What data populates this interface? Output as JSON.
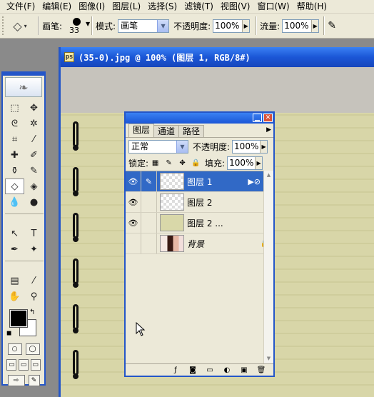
{
  "menu": [
    "文件(F)",
    "编辑(E)",
    "图像(I)",
    "图层(L)",
    "选择(S)",
    "滤镜(T)",
    "视图(V)",
    "窗口(W)",
    "帮助(H)"
  ],
  "options": {
    "brush_label": "画笔:",
    "brush_size": "33",
    "mode_label": "模式:",
    "mode_value": "画笔",
    "opacity_label": "不透明度:",
    "opacity_value": "100%",
    "flow_label": "流量:",
    "flow_value": "100%"
  },
  "document": {
    "title": "(35-0).jpg @ 100% (图层 1, RGB/8#)"
  },
  "layers_panel": {
    "tabs": [
      "图层",
      "通道",
      "路径"
    ],
    "active_tab": "图层",
    "blend_mode": "正常",
    "opacity_label": "不透明度:",
    "opacity_value": "100%",
    "lock_label": "锁定:",
    "fill_label": "填充:",
    "fill_value": "100%",
    "layers": [
      {
        "name": "图层 1",
        "visible": true,
        "selected": true,
        "thumb": "transparent"
      },
      {
        "name": "图层 2",
        "visible": true,
        "selected": false,
        "thumb": "transparent"
      },
      {
        "name": "图层 2 ...",
        "visible": true,
        "selected": false,
        "thumb": "paper"
      },
      {
        "name": "背景",
        "visible": false,
        "selected": false,
        "thumb": "photo",
        "locked": true
      }
    ]
  },
  "colors": {
    "titlebar": "#1b56d6",
    "selected_layer": "#3169c6",
    "chrome": "#ece9d8",
    "foreground": "#000000",
    "background": "#ffffff"
  }
}
